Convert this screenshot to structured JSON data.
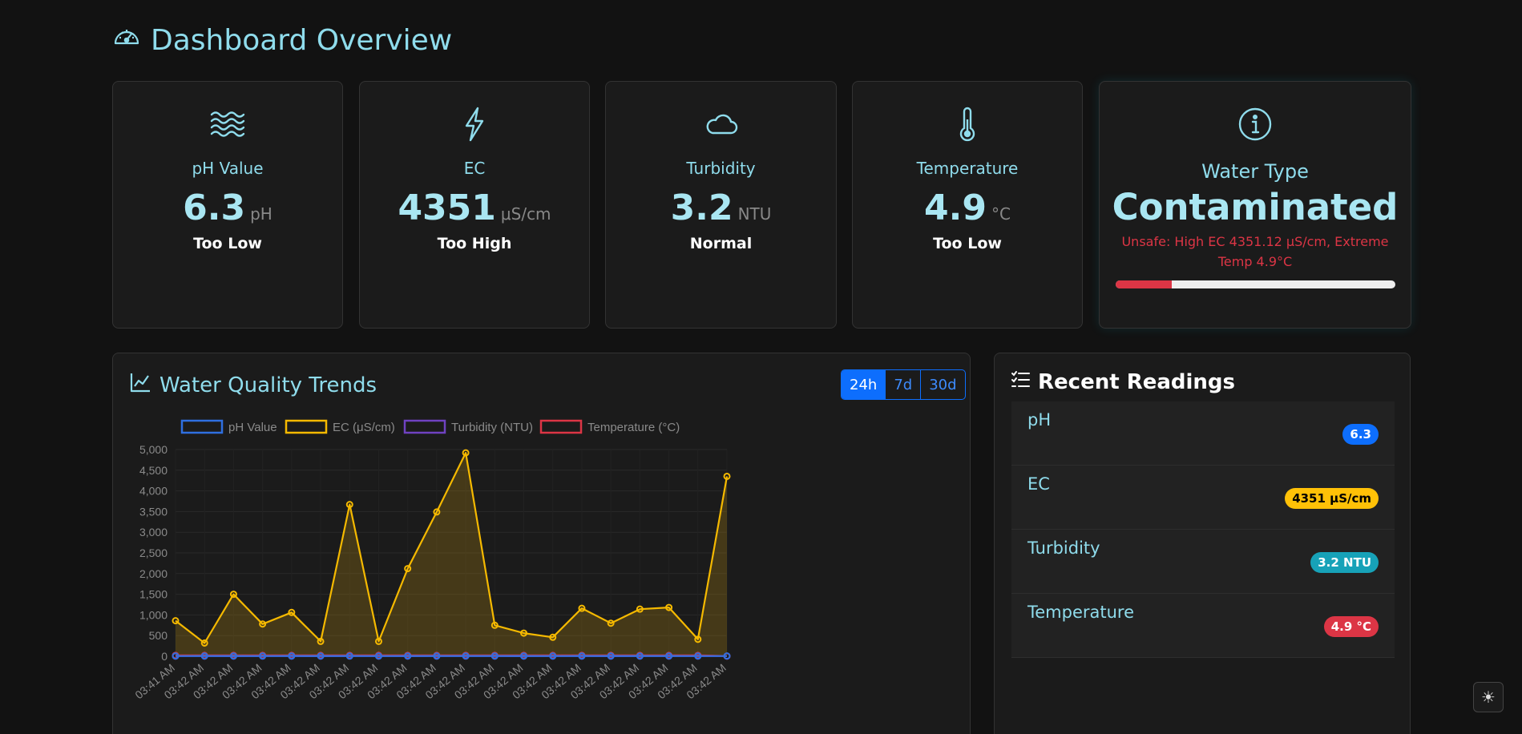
{
  "header": {
    "title": "Dashboard Overview",
    "icon": "speedometer-icon"
  },
  "cards": [
    {
      "icon": "water-waves-icon",
      "label": "pH Value",
      "value": "6.3",
      "unit": "pH",
      "status": "Too Low"
    },
    {
      "icon": "lightning-icon",
      "label": "EC",
      "value": "4351",
      "unit": "μS/cm",
      "status": "Too High"
    },
    {
      "icon": "cloud-icon",
      "label": "Turbidity",
      "value": "3.2",
      "unit": "NTU",
      "status": "Normal"
    },
    {
      "icon": "thermometer-icon",
      "label": "Temperature",
      "value": "4.9",
      "unit": "°C",
      "status": "Too Low"
    }
  ],
  "water_type": {
    "icon": "info-icon",
    "label": "Water Type",
    "value": "Contaminated",
    "reason": "Unsafe: High EC 4351.12 μS/cm, Extreme Temp 4.9°C",
    "safety_level": 0.2,
    "color": "#dc3545"
  },
  "trends": {
    "title": "Water Quality Trends",
    "icon": "line-chart-icon",
    "ranges": [
      "24h",
      "7d",
      "30d"
    ],
    "active_range": "24h"
  },
  "chart_data": {
    "type": "line",
    "categories": [
      "03:41 AM",
      "03:42 AM",
      "03:42 AM",
      "03:42 AM",
      "03:42 AM",
      "03:42 AM",
      "03:42 AM",
      "03:42 AM",
      "03:42 AM",
      "03:42 AM",
      "03:42 AM",
      "03:42 AM",
      "03:42 AM",
      "03:42 AM",
      "03:42 AM",
      "03:42 AM",
      "03:42 AM",
      "03:42 AM",
      "03:42 AM",
      "03:42 AM"
    ],
    "series": [
      {
        "name": "pH Value",
        "color": "#2f6fe0",
        "values": [
          6.5,
          6.8,
          7.0,
          6.7,
          7.1,
          7.3,
          6.9,
          6.6,
          7.0,
          6.8,
          7.2,
          6.9,
          7.1,
          6.7,
          7.0,
          6.8,
          6.9,
          7.2,
          6.5,
          6.3
        ]
      },
      {
        "name": "EC (μS/cm)",
        "color": "#f5b900",
        "fill": "rgba(150,115,20,0.35)",
        "values": [
          860,
          320,
          1500,
          780,
          1060,
          360,
          3670,
          360,
          2120,
          3490,
          4920,
          750,
          560,
          460,
          1160,
          800,
          1140,
          1180,
          410,
          4351
        ]
      },
      {
        "name": "Turbidity (NTU)",
        "color": "#6f42c1",
        "values": [
          3.0,
          3.5,
          2.8,
          4.1,
          3.3,
          2.9,
          3.8,
          3.1,
          2.6,
          3.4,
          3.9,
          3.0,
          2.7,
          3.6,
          3.2,
          2.8,
          3.5,
          3.1,
          3.3,
          3.2
        ]
      },
      {
        "name": "Temperature (°C)",
        "color": "#dc3545",
        "values": [
          22.1,
          21.8,
          22.5,
          23.0,
          22.4,
          21.9,
          22.7,
          23.1,
          22.0,
          21.6,
          22.3,
          22.9,
          22.2,
          21.7,
          22.6,
          23.0,
          22.4,
          21.9,
          22.8,
          4.9
        ]
      }
    ],
    "y_ticks": [
      "0",
      "500",
      "1,000",
      "1,500",
      "2,000",
      "2,500",
      "3,000",
      "3,500",
      "4,000",
      "4,500",
      "5,000"
    ],
    "ylim": [
      0,
      5000
    ],
    "grid": true,
    "legend": "top"
  },
  "recent": {
    "title": "Recent Readings",
    "icon": "list-icon",
    "items": [
      {
        "name": "pH",
        "value": "6.3",
        "bg": "#0d6efd",
        "fg": "#ffffff"
      },
      {
        "name": "EC",
        "value": "4351 μS/cm",
        "bg": "#ffc107",
        "fg": "#000000"
      },
      {
        "name": "Turbidity",
        "value": "3.2 NTU",
        "bg": "#17a2b8",
        "fg": "#ffffff"
      },
      {
        "name": "Temperature",
        "value": "4.9 °C",
        "bg": "#dc3545",
        "fg": "#ffffff"
      }
    ]
  },
  "theme_toggle": {
    "icon": "sun-icon",
    "glyph": "☀"
  }
}
